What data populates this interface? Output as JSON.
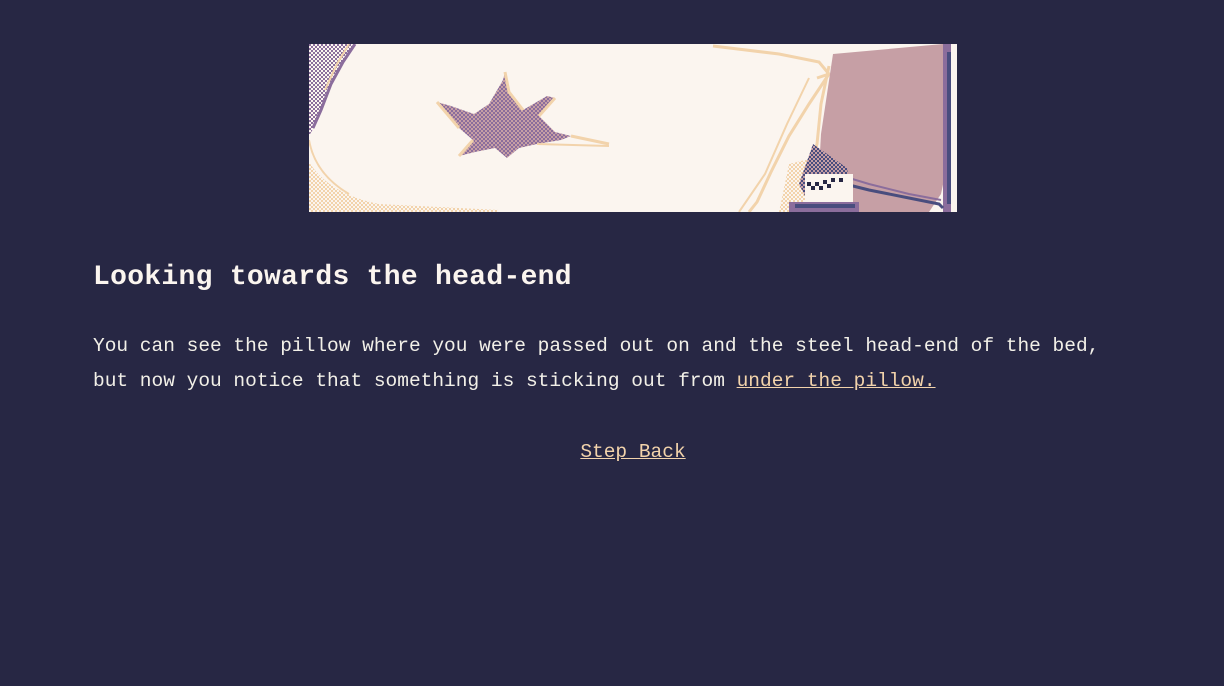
{
  "scene": {
    "image_subject": "pixel-art-pillow-head-end",
    "palette": {
      "background": "#272744",
      "pillow": "#fbf5ef",
      "pillow_shadow": "#f2d3ab",
      "stain": "#c69fa5",
      "wall": "#c69fa5",
      "shadow": "#8b6d9c",
      "frame": "#494d7e"
    }
  },
  "passage": {
    "title": "Looking towards the head-end",
    "text_before_link": "You can see the pillow where you were passed out on and the steel head-end of the bed, but now you notice that something is sticking out from ",
    "link_label": "under the pillow."
  },
  "nav": {
    "back_label": "Step Back"
  },
  "colors": {
    "background": "#272744",
    "text": "#f2f0e8",
    "link": "#f2d3ab"
  }
}
